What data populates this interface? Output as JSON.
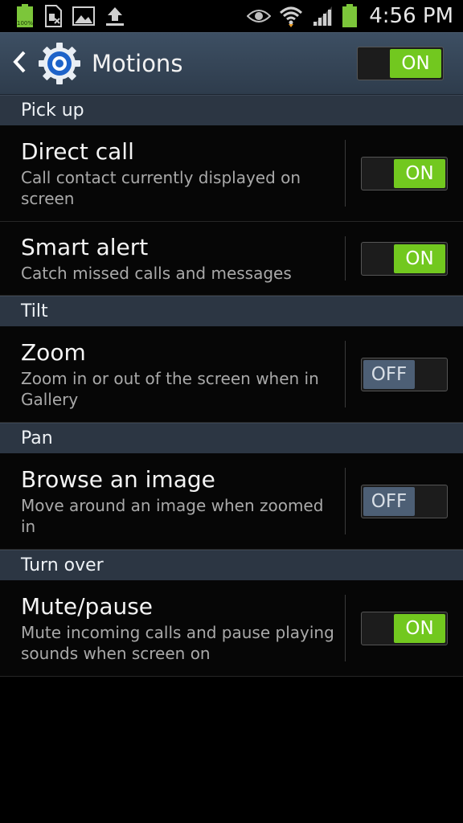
{
  "status_bar": {
    "battery_small_label": "100%",
    "time": "4:56 PM"
  },
  "action_bar": {
    "title": "Motions",
    "master_toggle": "ON"
  },
  "sections": [
    {
      "header": "Pick up",
      "items": [
        {
          "title": "Direct call",
          "summary": "Call contact currently displayed on screen",
          "toggle": "ON",
          "state": "on"
        },
        {
          "title": "Smart alert",
          "summary": "Catch missed calls and messages",
          "toggle": "ON",
          "state": "on"
        }
      ]
    },
    {
      "header": "Tilt",
      "items": [
        {
          "title": "Zoom",
          "summary": "Zoom in or out of the screen when in Gallery",
          "toggle": "OFF",
          "state": "off"
        }
      ]
    },
    {
      "header": "Pan",
      "items": [
        {
          "title": "Browse an image",
          "summary": "Move around an image when zoomed in",
          "toggle": "OFF",
          "state": "off"
        }
      ]
    },
    {
      "header": "Turn over",
      "items": [
        {
          "title": "Mute/pause",
          "summary": "Mute incoming calls and pause playing sounds when screen on",
          "toggle": "ON",
          "state": "on"
        }
      ]
    }
  ],
  "colors": {
    "toggle_on": "#72c81f",
    "toggle_off": "#4d5f75",
    "action_bar": "#3d4f63",
    "section_header": "#2c3643"
  },
  "icons": [
    "battery-icon",
    "sim-card-icon",
    "image-icon",
    "upload-icon",
    "eye-icon",
    "wifi-icon",
    "signal-icon",
    "battery-icon",
    "back-icon",
    "gear-icon"
  ]
}
